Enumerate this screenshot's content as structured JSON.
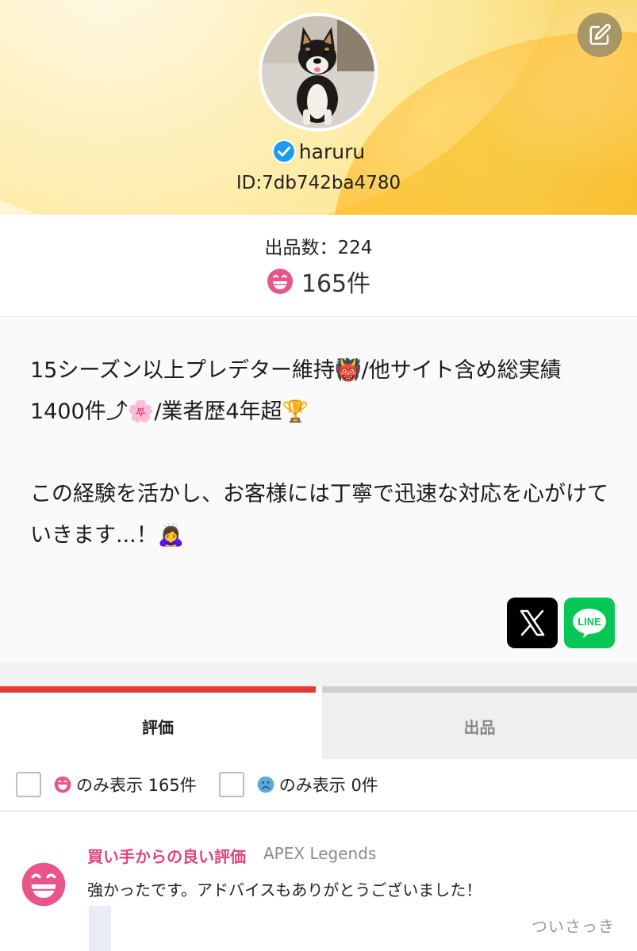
{
  "profile": {
    "username": "haruru",
    "user_id": "ID:7db742ba4780",
    "verified_icon": "verified-check-icon",
    "edit_icon": "edit-pencil-icon"
  },
  "stats": {
    "listing_count": "出品数：224",
    "rating_count": "165件",
    "rating_icon": "grinning-face-icon"
  },
  "bio": {
    "text": "15シーズン以上プレデター維持👹/他サイト含め総実績1400件⤴🌸/業者歴4年超🏆\n\nこの経験を活かし、お客様には丁寧で迅速な対応を心がけていきます...！🙇‍♀️"
  },
  "social": {
    "x_label": "X",
    "line_label": "LINE"
  },
  "tabs": [
    {
      "label": "評価",
      "active": true
    },
    {
      "label": "出品",
      "active": false
    }
  ],
  "filters": [
    {
      "label": "のみ表示 165件",
      "icon": "happy-face-icon",
      "checked": false
    },
    {
      "label": "のみ表示 0件",
      "icon": "sad-face-icon",
      "checked": false
    }
  ],
  "review": {
    "type": "買い手からの良い評価",
    "game": "APEX Legends",
    "body": "強かったです。アドバイスもありがとうございました！",
    "time": "ついさっき"
  },
  "colors": {
    "accent_red": "#e53935",
    "pink": "#e0447a",
    "line_green": "#06c755",
    "verified_blue": "#1d9bf0",
    "sad_blue": "#5aa9d6"
  }
}
